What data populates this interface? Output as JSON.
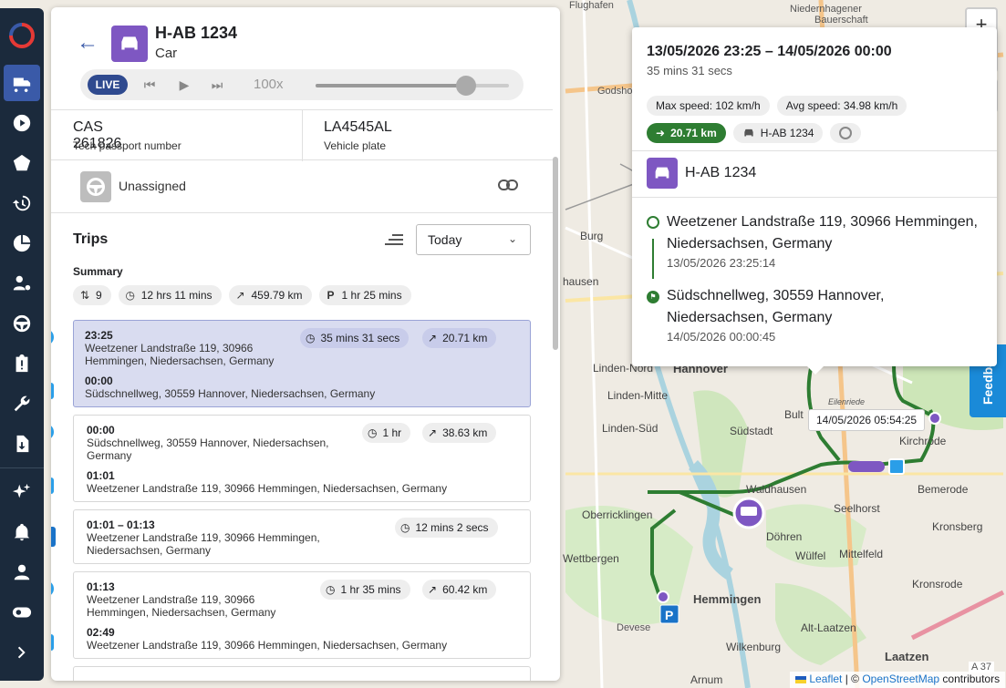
{
  "vehicle": {
    "name": "H-AB 1234",
    "type": "Car"
  },
  "player": {
    "live": "LIVE",
    "speed": "100x",
    "progress": 0.78
  },
  "info": {
    "tech_passport_value": "CAS 261826",
    "tech_passport_label": "Tech passport number",
    "plate_value": "LA4545AL",
    "plate_label": "Vehicle plate"
  },
  "driver": {
    "name": "Unassigned"
  },
  "trips": {
    "title": "Trips",
    "period": "Today",
    "summary_label": "Summary",
    "summary": {
      "count": "9",
      "duration": "12 hrs 11 mins",
      "distance": "459.79 km",
      "parking": "1 hr 25 mins"
    },
    "items": [
      {
        "kind": "trip",
        "start_time": "23:25",
        "start_addr": "Weetzener Landstraße 119, 30966 Hemmingen, Niedersachsen, Germany",
        "end_time": "00:00",
        "end_addr": "Südschnellweg, 30559 Hannover, Niedersachsen, Germany",
        "duration": "35 mins 31 secs",
        "distance": "20.71 km"
      },
      {
        "kind": "trip",
        "start_time": "00:00",
        "start_addr": "Südschnellweg, 30559 Hannover, Niedersachsen, Germany",
        "end_time": "01:01",
        "end_addr": "Weetzener Landstraße 119, 30966 Hemmingen, Niedersachsen, Germany",
        "duration": "1 hr",
        "distance": "38.63 km"
      },
      {
        "kind": "parking",
        "time": "01:01 – 01:13",
        "addr": "Weetzener Landstraße 119, 30966 Hemmingen, Niedersachsen, Germany",
        "duration": "12 mins 2 secs"
      },
      {
        "kind": "trip",
        "start_time": "01:13",
        "start_addr": "Weetzener Landstraße 119, 30966 Hemmingen, Niedersachsen, Germany",
        "end_time": "02:49",
        "end_addr": "Weetzener Landstraße 119, 30966 Hemmingen, Niedersachsen, Germany",
        "duration": "1 hr 35 mins",
        "distance": "60.42 km"
      }
    ]
  },
  "popup": {
    "range": "13/05/2026 23:25 – 14/05/2026 00:00",
    "duration": "35 mins 31 secs",
    "max_speed": "Max speed: 102 km/h",
    "avg_speed": "Avg speed: 34.98 km/h",
    "distance": "20.71 km",
    "plate": "H-AB 1234",
    "vehicle_name": "H-AB 1234",
    "start_addr": "Weetzener Landstraße 119, 30966 Hemmingen, Niedersachsen, Germany",
    "start_ts": "13/05/2026 23:25:14",
    "end_addr": "Südschnellweg, 30559 Hannover, Niedersachsen, Germany",
    "end_ts": "14/05/2026 00:00:45"
  },
  "map": {
    "tooltip": "14/05/2026 05:54:25",
    "feedback": "Feedback",
    "attribution_leaflet": "Leaflet",
    "attribution_sep": " | © ",
    "attribution_osm": "OpenStreetMap",
    "attribution_tail": " contributors",
    "labels": [
      "Flughafen",
      "Niedernhagener",
      "Bauerschaft",
      "Godsho",
      "Burg",
      "hausen",
      "Linden-Nord",
      "Hannover",
      "Linden-Mitte",
      "Linden-Süd",
      "Südstadt",
      "Bult",
      "Kirchrode",
      "Bemerode",
      "Waldhausen",
      "Seelhorst",
      "Oberricklingen",
      "Döhren",
      "Kronsberg",
      "Wettbergen",
      "Wülfel",
      "Mittelfeld",
      "Kronsrode",
      "Hemmingen",
      "Devese",
      "Alt-Laatzen",
      "Wilkenburg",
      "Laatzen",
      "Arnum",
      "A 37",
      "Eilenriede"
    ],
    "route_color": "#2e7d32"
  }
}
